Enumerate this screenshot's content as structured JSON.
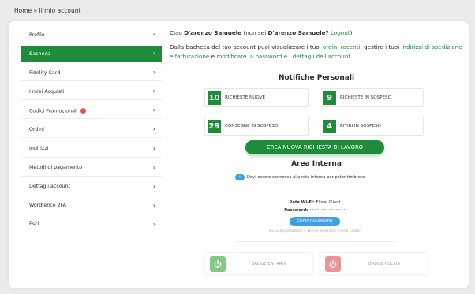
{
  "breadcrumb": "Home » Il mio account",
  "sidebar": {
    "items": [
      {
        "label": "Profilo"
      },
      {
        "label": "Bacheca"
      },
      {
        "label": "Fidelity Card"
      },
      {
        "label": "I miei Acquisti"
      },
      {
        "label": "Codici Promozionali",
        "badge": "!"
      },
      {
        "label": "Ordini"
      },
      {
        "label": "Indirizzi"
      },
      {
        "label": "Metodi di pagamento"
      },
      {
        "label": "Dettagli account"
      },
      {
        "label": "Wordfence 2FA"
      },
      {
        "label": "Esci"
      }
    ],
    "chevron": "›"
  },
  "greeting": {
    "prefix": "Ciao ",
    "name": "D'arenzo Samuele",
    "middle": " (non sei ",
    "name2": "D'arenzo Samuele?",
    "logout": " Logout",
    "suffix": ")"
  },
  "intro": {
    "text1": "Dalla bacheca del tuo account puoi visualizzare i tuoi ",
    "link1": "ordini recenti",
    "text2": ", gestire i tuoi ",
    "link2": "indirizzi di spedizione e fatturazione",
    "text3": " e ",
    "link3": "modificare la password e i dettagli dell'account",
    "text4": "."
  },
  "notifiche": {
    "title": "Notifiche Personali",
    "items": [
      {
        "count": "10",
        "label": "RICHIESTE NUOVE"
      },
      {
        "count": "9",
        "label": "RICHIESTE IN SOSPESO"
      },
      {
        "count": "29",
        "label": "CONSEGNE IN SOSPESO"
      },
      {
        "count": "4",
        "label": "RITIRI IN SOSPESO"
      }
    ]
  },
  "cta_label": "CREA NUOVA RICHIESTA DI LAVORO",
  "area_interna": {
    "title": "Area Interna",
    "info_badge": "i",
    "notice": "Devi essere connesso alla rete interna per poter timbrare.",
    "wifi_label": "Rete Wi-Fi:",
    "wifi_value": "Floral Client",
    "password_label": "Password:",
    "password_value": "•••••••••••••••",
    "copy_label": "COPIA PASSWORD",
    "hint": "Vai su Impostazioni > Wi-Fi e seleziona \"Floral Client\""
  },
  "badges": {
    "entrata_label": "BADGE ENTRATA",
    "uscita_label": "BADGE USCITA",
    "entrata_color": "#5cb85c",
    "uscita_color": "#e8707a"
  },
  "colors": {
    "accent": "#1e8c3a",
    "info": "#3ba0e6"
  }
}
